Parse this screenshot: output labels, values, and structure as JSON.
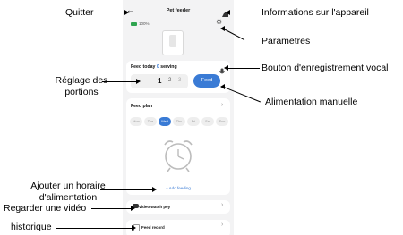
{
  "header": {
    "title": "Pet feeder",
    "battery": "100%"
  },
  "feed_today": {
    "label": "Feed today",
    "count": "0",
    "suffix": "serving",
    "portions": [
      "1",
      "2",
      "3"
    ],
    "feed_button": "Feed"
  },
  "feed_plan": {
    "title": "Feed plan",
    "days": [
      "Mon",
      "Tue",
      "Wed",
      "Thu",
      "Fri",
      "Sat",
      "Sun"
    ],
    "active_day": "Wed",
    "add_feeding": "+ Add feeding"
  },
  "video": {
    "label": "Video watch pey"
  },
  "record": {
    "label": "Feed record"
  },
  "annotations": {
    "quit": "Quitter",
    "device_info": "Informations sur l'appareil",
    "settings": "Parametres",
    "voice_record": "Bouton d'enregistrement vocal",
    "portion_setting": "Réglage des\nportions",
    "manual_feeding": "Alimentation manuelle",
    "add_schedule": "Ajouter un horaire\nd'alimentation",
    "watch_video": "Regarder une vidéo",
    "history": "historique"
  },
  "colors": {
    "accent": "#3a7bd5",
    "green": "#2ea44f"
  }
}
